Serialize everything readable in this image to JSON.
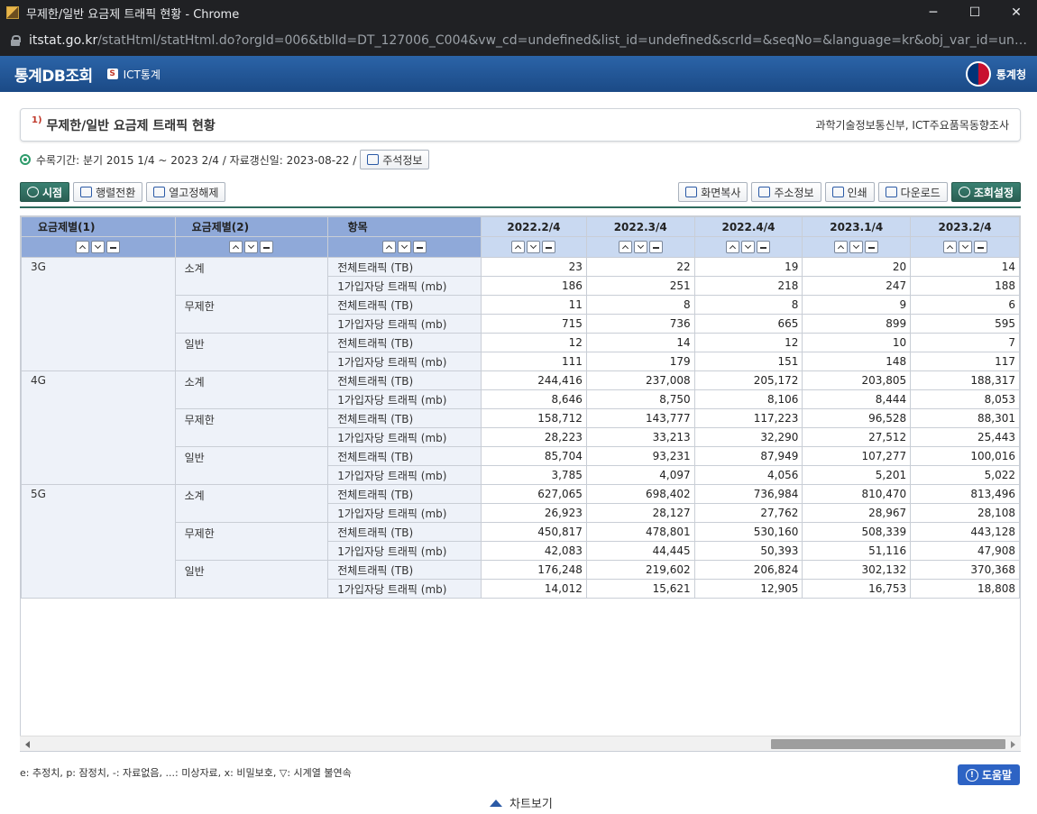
{
  "window": {
    "title": "무제한/일반 요금제 트래픽 현황 - Chrome",
    "minimize": "─",
    "maximize": "☐",
    "close": "✕"
  },
  "url": {
    "host": "itstat.go.kr",
    "path": "/statHtml/statHtml.do?orgId=006&tblId=DT_127006_C004&vw_cd=undefined&list_id=undefined&scrId=&seqNo=&language=kr&obj_var_id=undefined&itm_id..."
  },
  "header": {
    "brand": "통계DB조회",
    "ict_badge": "S",
    "ict_label": "ICT통계",
    "org": "통계청"
  },
  "table_title": {
    "sup": "1)",
    "title": "무제한/일반 요금제 트래픽 현황",
    "source": "과학기술정보통신부, ICT주요품목동향조사"
  },
  "info": {
    "period": "수록기간: 분기 2015 1/4 ~ 2023 2/4 / 자료갱신일: 2023-08-22 /",
    "note_button": "주석정보"
  },
  "toolbar": {
    "timepoint": "시점",
    "pivot": "행렬전환",
    "fixed_col": "열고정해제",
    "copy": "화면복사",
    "address": "주소정보",
    "print": "인쇄",
    "download": "다운로드",
    "settings": "조회설정"
  },
  "table": {
    "headers": [
      "요금제별(1)",
      "요금제별(2)",
      "항목",
      "2022.2/4",
      "2022.3/4",
      "2022.4/4",
      "2023.1/4",
      "2023.2/4"
    ],
    "rows": [
      {
        "g1": "3G",
        "g2": "소계",
        "item": "전체트래픽 (TB)",
        "v": [
          "23",
          "22",
          "19",
          "20",
          "14"
        ]
      },
      {
        "g1": "",
        "g2": "",
        "item": "1가입자당 트래픽 (mb)",
        "v": [
          "186",
          "251",
          "218",
          "247",
          "188"
        ]
      },
      {
        "g1": "",
        "g2": "무제한",
        "item": "전체트래픽 (TB)",
        "v": [
          "11",
          "8",
          "8",
          "9",
          "6"
        ]
      },
      {
        "g1": "",
        "g2": "",
        "item": "1가입자당 트래픽 (mb)",
        "v": [
          "715",
          "736",
          "665",
          "899",
          "595"
        ]
      },
      {
        "g1": "",
        "g2": "일반",
        "item": "전체트래픽 (TB)",
        "v": [
          "12",
          "14",
          "12",
          "10",
          "7"
        ]
      },
      {
        "g1": "",
        "g2": "",
        "item": "1가입자당 트래픽 (mb)",
        "v": [
          "111",
          "179",
          "151",
          "148",
          "117"
        ]
      },
      {
        "g1": "4G",
        "g2": "소계",
        "item": "전체트래픽 (TB)",
        "v": [
          "244,416",
          "237,008",
          "205,172",
          "203,805",
          "188,317"
        ]
      },
      {
        "g1": "",
        "g2": "",
        "item": "1가입자당 트래픽 (mb)",
        "v": [
          "8,646",
          "8,750",
          "8,106",
          "8,444",
          "8,053"
        ]
      },
      {
        "g1": "",
        "g2": "무제한",
        "item": "전체트래픽 (TB)",
        "v": [
          "158,712",
          "143,777",
          "117,223",
          "96,528",
          "88,301"
        ]
      },
      {
        "g1": "",
        "g2": "",
        "item": "1가입자당 트래픽 (mb)",
        "v": [
          "28,223",
          "33,213",
          "32,290",
          "27,512",
          "25,443"
        ]
      },
      {
        "g1": "",
        "g2": "일반",
        "item": "전체트래픽 (TB)",
        "v": [
          "85,704",
          "93,231",
          "87,949",
          "107,277",
          "100,016"
        ]
      },
      {
        "g1": "",
        "g2": "",
        "item": "1가입자당 트래픽 (mb)",
        "v": [
          "3,785",
          "4,097",
          "4,056",
          "5,201",
          "5,022"
        ]
      },
      {
        "g1": "5G",
        "g2": "소계",
        "item": "전체트래픽 (TB)",
        "v": [
          "627,065",
          "698,402",
          "736,984",
          "810,470",
          "813,496"
        ]
      },
      {
        "g1": "",
        "g2": "",
        "item": "1가입자당 트래픽 (mb)",
        "v": [
          "26,923",
          "28,127",
          "27,762",
          "28,967",
          "28,108"
        ]
      },
      {
        "g1": "",
        "g2": "무제한",
        "item": "전체트래픽 (TB)",
        "v": [
          "450,817",
          "478,801",
          "530,160",
          "508,339",
          "443,128"
        ]
      },
      {
        "g1": "",
        "g2": "",
        "item": "1가입자당 트래픽 (mb)",
        "v": [
          "42,083",
          "44,445",
          "50,393",
          "51,116",
          "47,908"
        ]
      },
      {
        "g1": "",
        "g2": "일반",
        "item": "전체트래픽 (TB)",
        "v": [
          "176,248",
          "219,602",
          "206,824",
          "302,132",
          "370,368"
        ]
      },
      {
        "g1": "",
        "g2": "",
        "item": "1가입자당 트래픽 (mb)",
        "v": [
          "14,012",
          "15,621",
          "12,905",
          "16,753",
          "18,808"
        ]
      }
    ]
  },
  "legend": "e: 추정치, p: 잠정치, -: 자료없음, ...: 미상자료, x: 비밀보호, ▽: 시계열 불연속",
  "help": "도움말",
  "chart_toggle": "차트보기"
}
